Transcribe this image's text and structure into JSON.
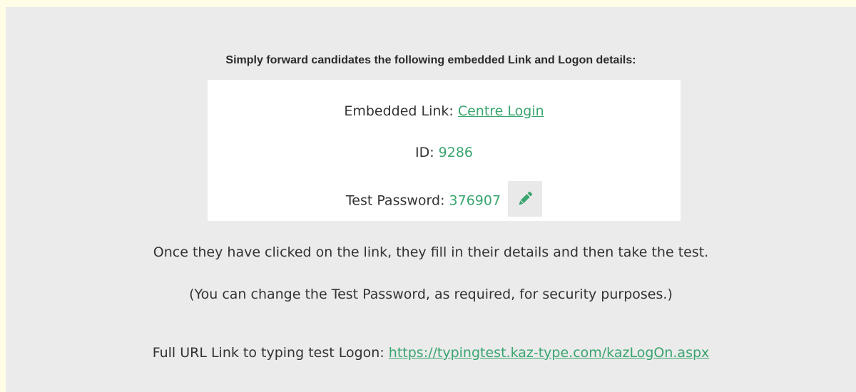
{
  "heading": "Simply forward candidates the following embedded Link and Logon details:",
  "details": {
    "embedded_link_label": "Embedded Link:",
    "embedded_link_text": "Centre Login",
    "id_label": "ID:",
    "id_value": "9286",
    "password_label": "Test Password:",
    "password_value": "376907",
    "edit_icon": "pencil-icon"
  },
  "info": {
    "line1": "Once they have clicked on the link, they fill in their details and then take the test.",
    "line2": "(You can change the Test Password, as required, for security purposes.)"
  },
  "full_url": {
    "label": "Full URL Link to typing test Logon:",
    "url": "https://typingtest.kaz-type.com/kazLogOn.aspx"
  },
  "colors": {
    "page_bg": "#fffde6",
    "panel_bg": "#ebebeb",
    "accent": "#3aa56f"
  }
}
